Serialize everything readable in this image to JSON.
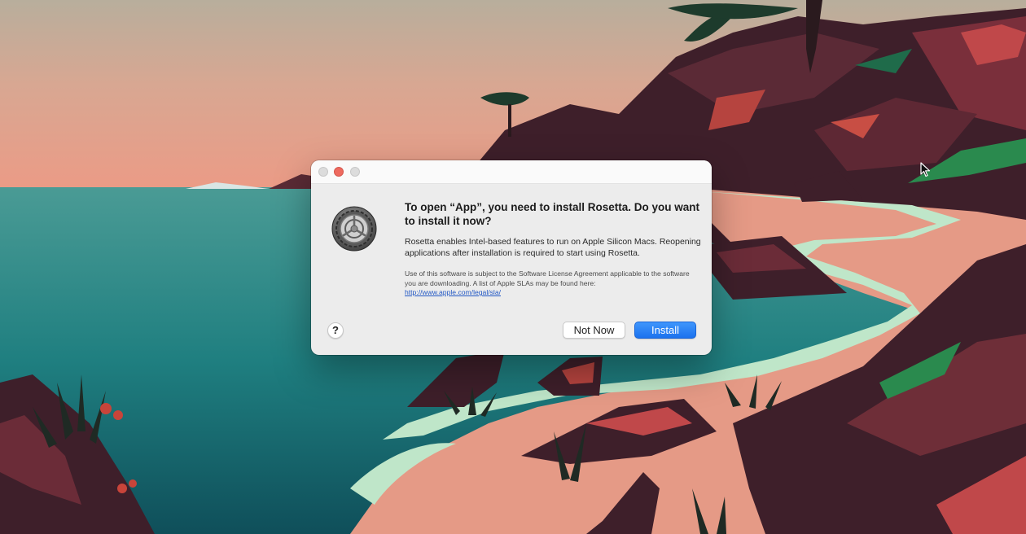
{
  "wallpaper": {
    "colors": {
      "sky": "#d8a792",
      "sky_low": "#eb9b86",
      "sea": "#2a8a86",
      "sea_deep": "#0f4f5a",
      "sand": "#e59a86",
      "foam": "#bfe6c9",
      "rock": "#3e1f2a",
      "rock_red": "#c0484a"
    }
  },
  "dialog": {
    "headline": "To open “App”, you need to install Rosetta.  Do you want to install it now?",
    "body": "Rosetta enables Intel-based features to run on Apple Silicon Macs. Reopening applications after installation is required to start using Rosetta.",
    "legal": "Use of this software is subject to the Software License Agreement applicable to the software you are downloading. A list of Apple SLAs may be found here:",
    "legal_link": "http://www.apple.com/legal/sla/",
    "icon": "system-preferences-gear-icon",
    "help_label": "?",
    "buttons": {
      "not_now": "Not Now",
      "install": "Install"
    },
    "colors": {
      "accent": "#1c72ee",
      "close_light": "#ee6a5f",
      "panel": "#ececec"
    }
  }
}
